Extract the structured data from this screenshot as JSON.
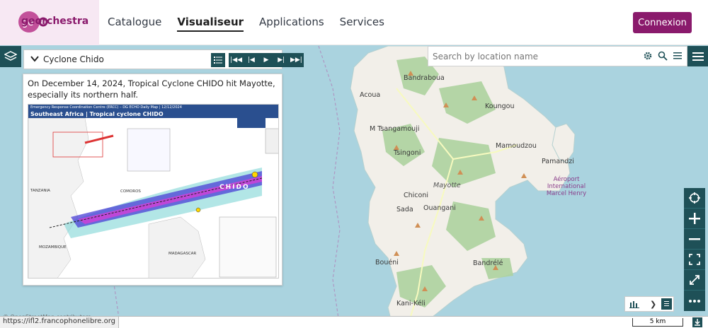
{
  "header": {
    "logo_text": "georchestra",
    "nav": [
      {
        "label": "Catalogue",
        "active": false
      },
      {
        "label": "Visualiseur",
        "active": true
      },
      {
        "label": "Applications",
        "active": false
      },
      {
        "label": "Services",
        "active": false
      }
    ],
    "login_label": "Connexion"
  },
  "layer": {
    "name": "Cyclone Chido",
    "description": "On December 14, 2024, Tropical Cyclone CHIDO hit Mayotte, especially its northern half."
  },
  "legend_image": {
    "header": "Emergency Response Coordination Centre (ERCC) – DG ECHO Daily Map | 12/12/2024",
    "title": "Southeast Africa | Tropical cyclone CHIDO",
    "label_chido": "CHIDO",
    "labels": [
      "TANZANIA",
      "COMOROS",
      "MOZAMBIQUE",
      "MADAGASCAR"
    ]
  },
  "search": {
    "placeholder": "Search by location name"
  },
  "map": {
    "places": [
      "Bandraboua",
      "Acoua",
      "Koungou",
      "M Tsangamouji",
      "Mamoudzou",
      "Tsingoni",
      "Pamandzi",
      "Aéroport International Marcel Henry",
      "Mayotte",
      "Chiconi",
      "Sada",
      "Ouangani",
      "Bouéni",
      "Bandrélé",
      "Kani-Kéli",
      "Mayotte"
    ],
    "attribution": "© OpenStreetMap contributors"
  },
  "status": {
    "url": "https://ifl2.francophonelibre.org",
    "scale": "5 km"
  },
  "colors": {
    "primary": "#1e5057",
    "brand": "#8a1a6c",
    "sea": "#aad3df",
    "land": "#f2efe9"
  }
}
